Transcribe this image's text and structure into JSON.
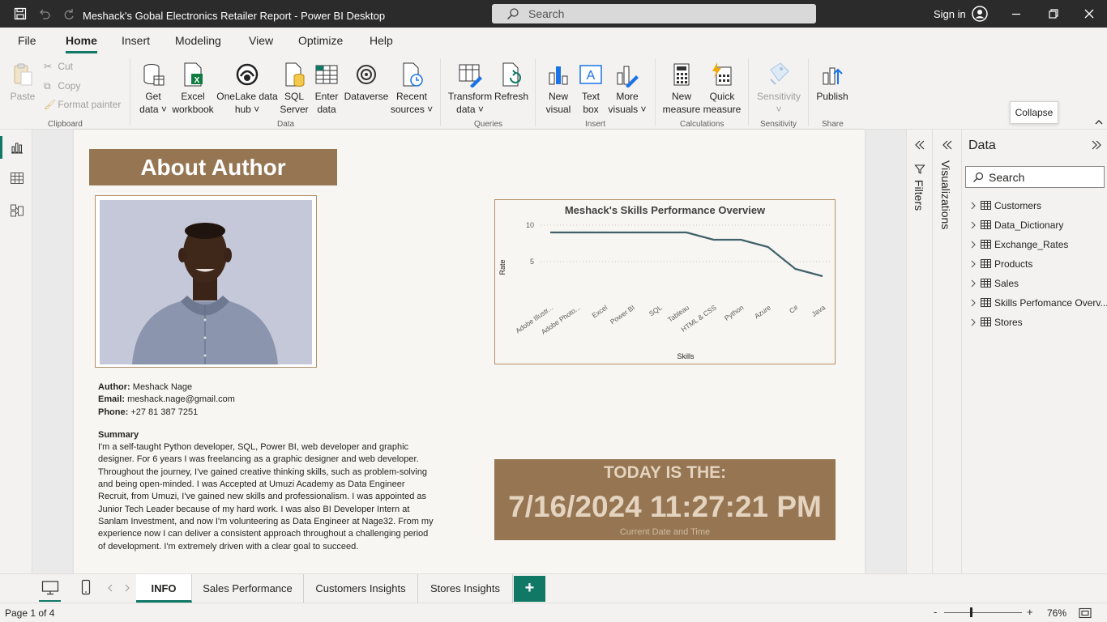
{
  "window": {
    "title": "Meshack's Gobal Electronics Retailer Report - Power BI Desktop",
    "search_placeholder": "Search",
    "sign_in": "Sign in"
  },
  "menu": {
    "items": [
      "File",
      "Home",
      "Insert",
      "Modeling",
      "View",
      "Optimize",
      "Help"
    ],
    "active": "Home"
  },
  "ribbon": {
    "clipboard": {
      "paste": "Paste",
      "cut": "Cut",
      "copy": "Copy",
      "format_painter": "Format painter",
      "label": "Clipboard"
    },
    "data": {
      "get_data": [
        "Get",
        "data"
      ],
      "excel": [
        "Excel",
        "workbook"
      ],
      "onelake": [
        "OneLake data",
        "hub"
      ],
      "sql": [
        "SQL",
        "Server"
      ],
      "enter": [
        "Enter",
        "data"
      ],
      "dataverse": "Dataverse",
      "recent": [
        "Recent",
        "sources"
      ],
      "label": "Data"
    },
    "queries": {
      "transform": [
        "Transform",
        "data"
      ],
      "refresh": "Refresh",
      "label": "Queries"
    },
    "insert": {
      "new_visual": [
        "New",
        "visual"
      ],
      "text_box": [
        "Text",
        "box"
      ],
      "more_visuals": [
        "More",
        "visuals"
      ],
      "label": "Insert"
    },
    "calculations": {
      "new_measure": [
        "New",
        "measure"
      ],
      "quick_measure": [
        "Quick",
        "measure"
      ],
      "label": "Calculations"
    },
    "sensitivity": {
      "btn": "Sensitivity",
      "label": "Sensitivity"
    },
    "share": {
      "publish": "Publish",
      "label": "Share"
    }
  },
  "tooltip": "Collapse",
  "report": {
    "banner": "About Author",
    "author_label": "Author:",
    "author": "Meshack Nage",
    "email_label": "Email:",
    "email": "meshack.nage@gmail.com",
    "phone_label": "Phone:",
    "phone": "+27 81 387 7251",
    "summary_title": "Summary",
    "summary": "I'm a self-taught Python developer, SQL, Power BI, web developer and graphic designer. For 6 years I was freelancing as a graphic designer and web developer. Throughout the journey, I've gained creative thinking skills, such as problem-solving and being open-minded. I was Accepted at Umuzi Academy as Data Engineer Recruit, from Umuzi, I've gained new skills and professionalism. I was appointed as Junior Tech Leader because of my hard work. I was also BI Developer Intern at Sanlam Investment, and now I'm volunteering as Data Engineer at Nage32. From my experience now I can deliver a consistent approach throughout a challenging period of development. I'm extremely driven with a clear goal to succeed.",
    "today_label": "TODAY IS THE:",
    "today_value": "7/16/2024 11:27:21 PM",
    "today_sub": "Current Date and Time"
  },
  "chart_data": {
    "type": "line",
    "title": "Meshack's Skills Performance Overview",
    "xlabel": "Skills",
    "ylabel": "Rate",
    "categories": [
      "Adobe Illustr...",
      "Adobe Photo...",
      "Excel",
      "Power BI",
      "SQL",
      "Tableau",
      "HTML & CSS",
      "Python",
      "Azure",
      "C#",
      "Java"
    ],
    "values": [
      9,
      9,
      9,
      9,
      9,
      9,
      8,
      8,
      7,
      4,
      3
    ],
    "yticks": [
      5,
      10
    ],
    "ylim": [
      1,
      10
    ],
    "grid": true,
    "color": "#41626b"
  },
  "panes": {
    "filters": "Filters",
    "visualizations": "Visualizations",
    "data_title": "Data",
    "search_placeholder": "Search",
    "tables": [
      "Customers",
      "Data_Dictionary",
      "Exchange_Rates",
      "Products",
      "Sales",
      "Skills Perfomance Overv...",
      "Stores"
    ]
  },
  "pages": {
    "tabs": [
      "INFO",
      "Sales Performance",
      "Customers Insights",
      "Stores Insights"
    ],
    "active": "INFO",
    "add": "+"
  },
  "status": {
    "page": "Page 1 of 4",
    "zoom": "76%"
  },
  "colors": {
    "accent": "#117865",
    "brown": "#957552",
    "line": "#41626b"
  }
}
